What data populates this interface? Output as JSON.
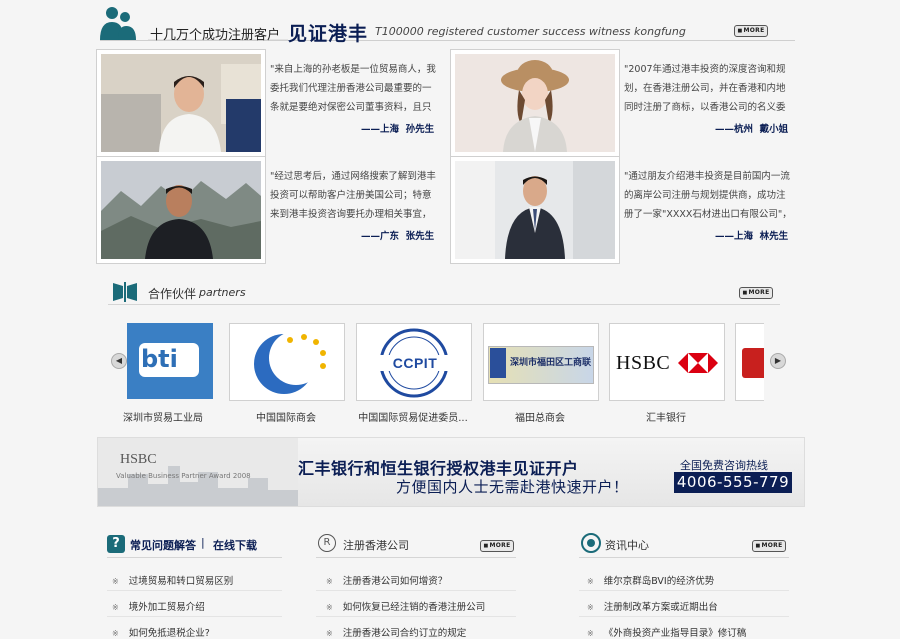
{
  "header": {
    "title_cn": "十几万个成功注册客户",
    "title_em": "见证港丰",
    "title_en": "T100000 registered customer success witness kongfung",
    "more_label": "MORE"
  },
  "testimonials": [
    {
      "text": "\"来自上海的孙老板是一位贸易商人，我委托我们代理注册香港公司最重要的一条就是要绝对保密公司董事资料，且只需要一",
      "author": "——上海  孙先生"
    },
    {
      "text": "\"2007年通过港丰投资的深度咨询和规划，在香港注册公司，并在香港和内地同时注册了商标，以香港公司的名义委托相关工",
      "author": "——杭州  戴小姐"
    },
    {
      "text": "\"经过思考后，通过网络搜索了解到港丰投资可以帮助客户注册美国公司；特意来到港丰投资咨询要托办理相关事宜，港丰投",
      "author": "——广东  张先生"
    },
    {
      "text": "\"通过朋友介绍港丰投资是目前国内一流的离岸公司注册与规划提供商，成功注册了一家\"XXXX石材进出口有限公司\"，不但",
      "author": "——上海  林先生"
    }
  ],
  "partners": {
    "title_cn": "合作伙伴",
    "title_en": "partners",
    "more_label": "MORE",
    "prev_arrow": "◀",
    "next_arrow": "▶",
    "items": [
      {
        "label": "深圳市贸易工业局",
        "logo_text": "bti"
      },
      {
        "label": "中国国际商会",
        "logo_text": ""
      },
      {
        "label": "中国国际贸易促进委员...",
        "logo_text": "CCPIT"
      },
      {
        "label": "福田总商会",
        "logo_text": "深圳市福田区工商联"
      },
      {
        "label": "汇丰银行",
        "logo_text": "HSBC"
      }
    ]
  },
  "banner": {
    "hsbc_text": "HSBC",
    "title": "汇丰银行和恒生银行授权港丰见证开户",
    "subtitle": "方便国内人士无需赴港快速开户！",
    "hotline_label": "全国免费咨询热线",
    "hotline_number": "4006-555-779",
    "award_text": "Valuable Business Partner Award 2008"
  },
  "columns": [
    {
      "title": "常见问题解答",
      "title2": "在线下载",
      "items": [
        "过境贸易和转口贸易区别",
        "境外加工贸易介绍",
        "如何免抵退税企业?"
      ]
    },
    {
      "title": "注册香港公司",
      "more_label": "MORE",
      "items": [
        "注册香港公司如何增资？",
        "如何恢复已经注销的香港注册公司",
        "注册香港公司合约订立的规定"
      ]
    },
    {
      "title": "资讯中心",
      "more_label": "MORE",
      "items": [
        "维尔京群岛BVI的经济优势",
        "注册制改革方案或近期出台",
        "《外商投资产业指导目录》修订稿"
      ]
    }
  ],
  "colors": {
    "navy": "#0b1e54",
    "teal": "#1b6b79",
    "separator": "#d5d5d5"
  }
}
